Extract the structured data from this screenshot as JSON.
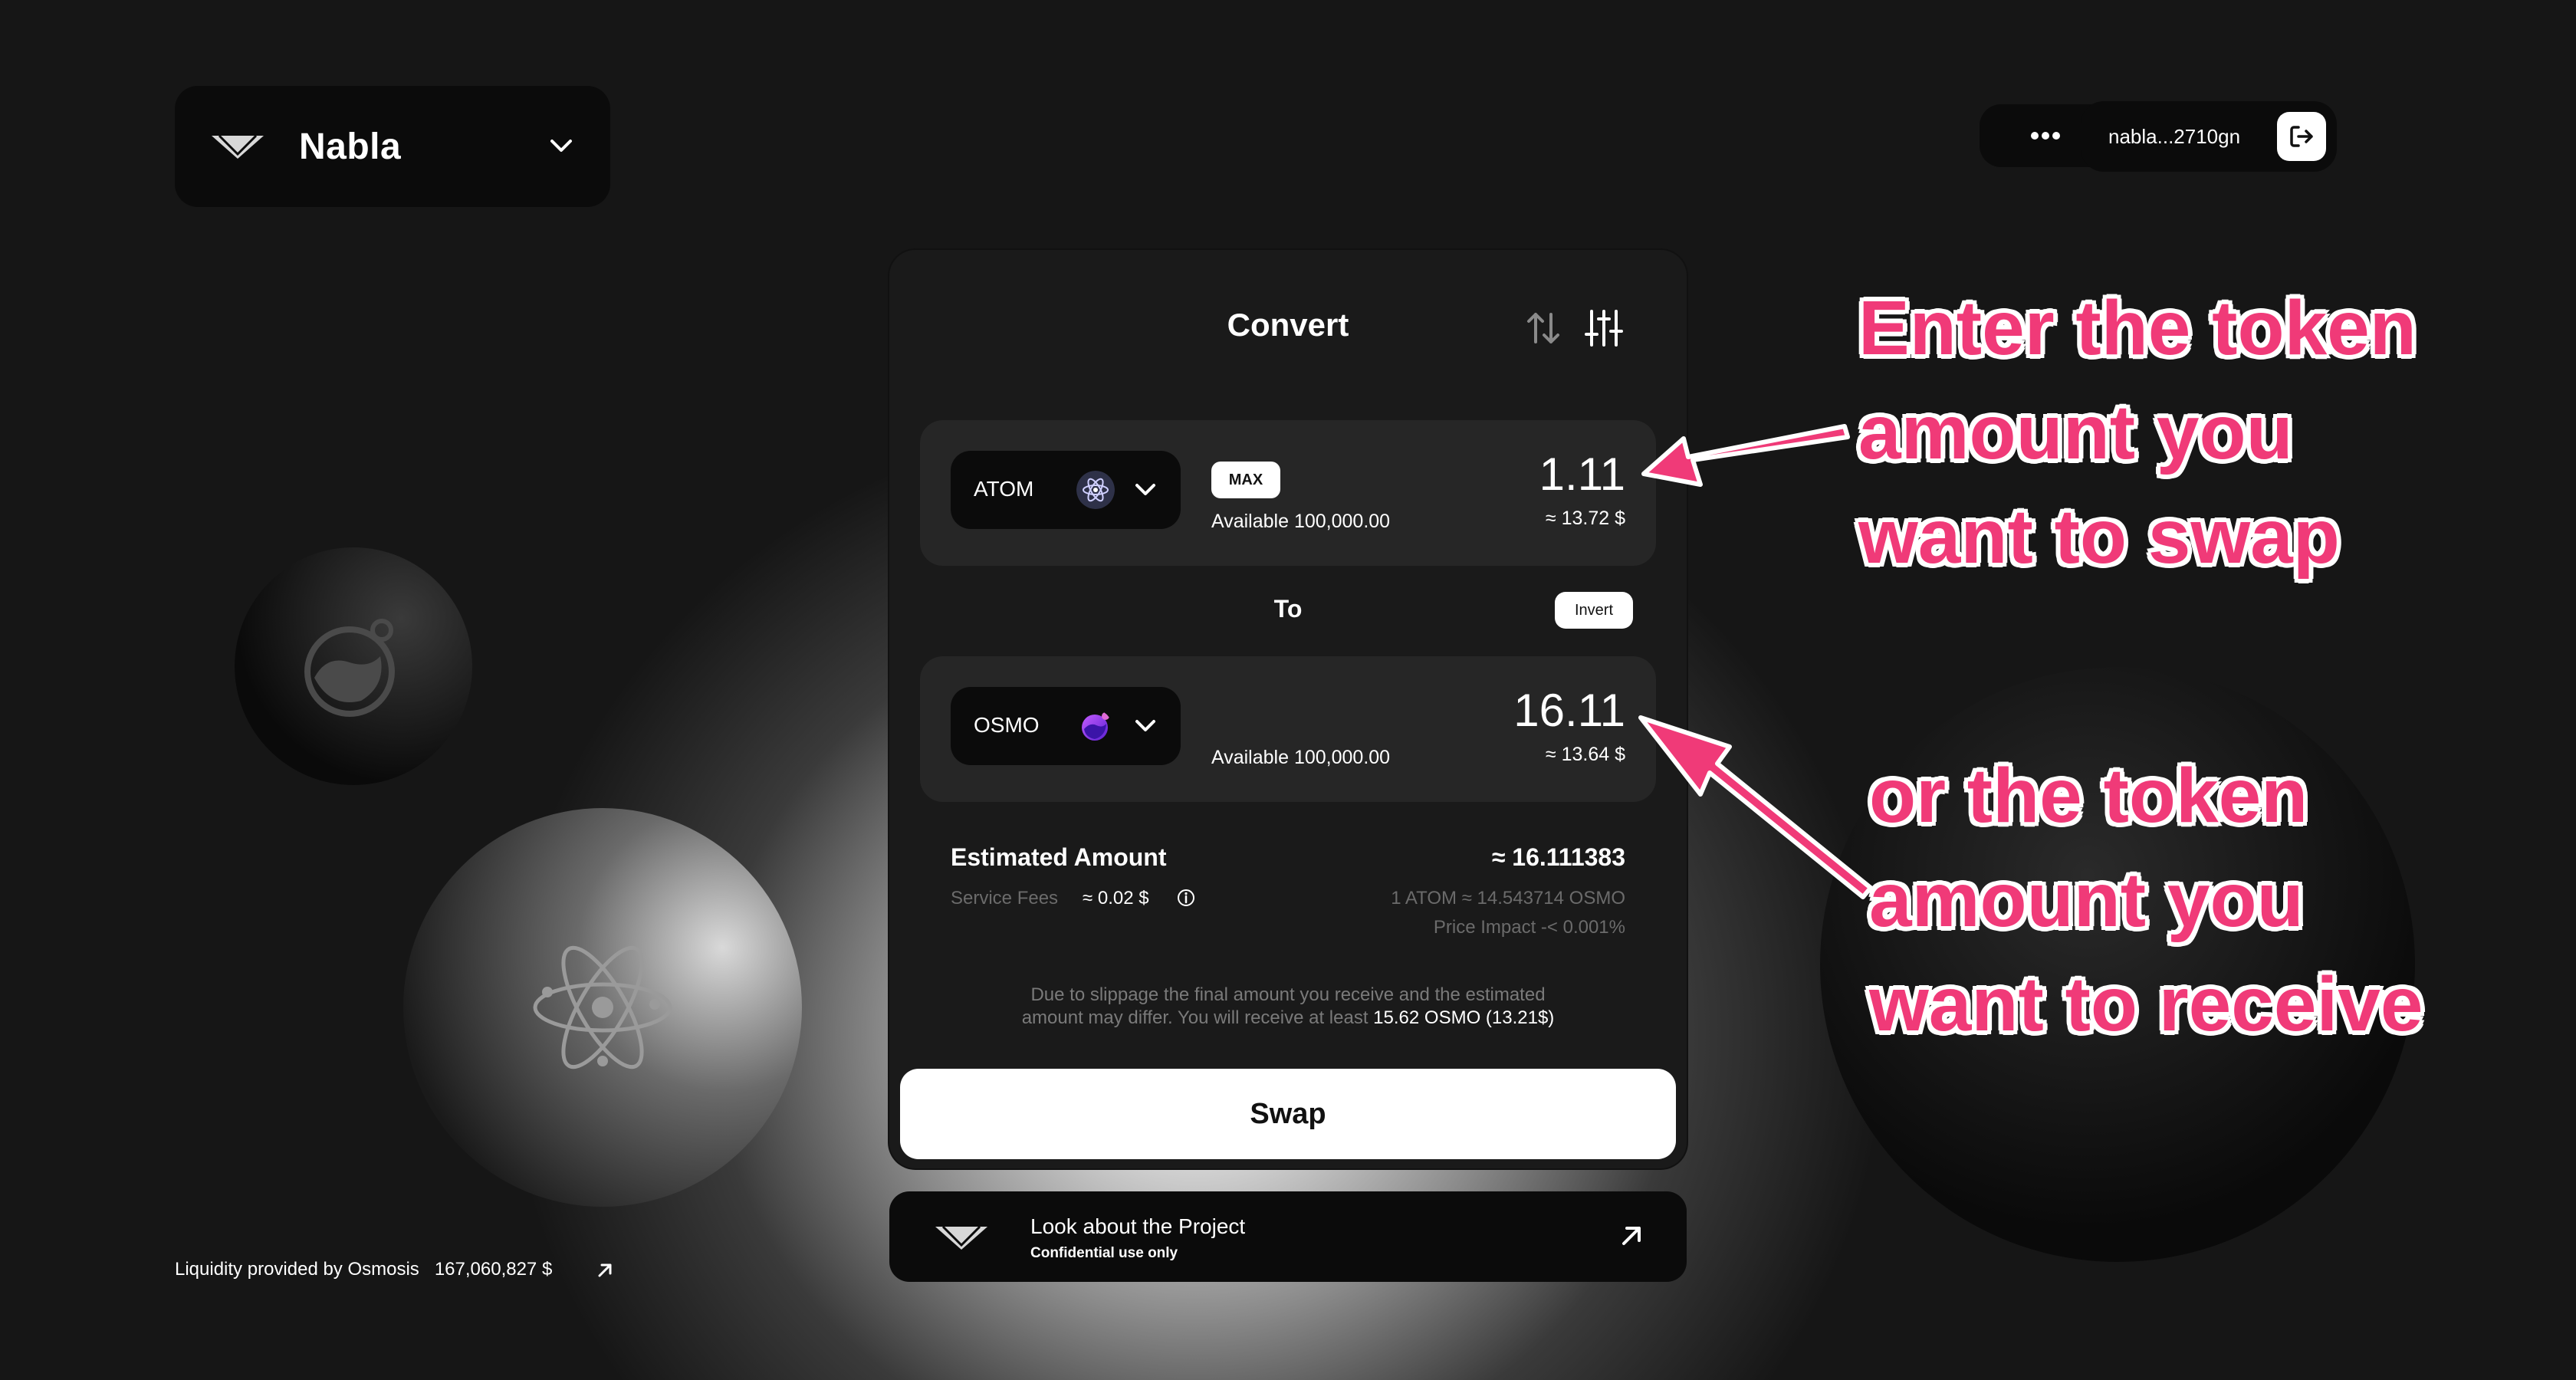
{
  "header": {
    "brand_name": "Nabla",
    "wallet_address": "nabla...2710gn"
  },
  "convert": {
    "title": "Convert",
    "from": {
      "token": "ATOM",
      "max_label": "MAX",
      "available": "Available 100,000.00",
      "amount": "1.11",
      "usd": "≈ 13.72 $"
    },
    "to_label": "To",
    "invert_label": "Invert",
    "to": {
      "token": "OSMO",
      "available": "Available 100,000.00",
      "amount": "16.11",
      "usd": "≈ 13.64 $"
    },
    "estimated_label": "Estimated Amount",
    "estimated_value": "≈ 16.111383",
    "fees_label": "Service Fees",
    "fees_value": "≈ 0.02 $",
    "rate": "1 ATOM ≈ 14.543714 OSMO",
    "price_impact": "Price Impact -< 0.001%",
    "slippage_line1": "Due to slippage the final amount you receive and the estimated",
    "slippage_line2": "amount may differ. You will receive at least",
    "slippage_min": "15.62 OSMO (13.21$)",
    "swap_label": "Swap"
  },
  "project": {
    "title": "Look about the Project",
    "subtitle": "Confidential use only"
  },
  "footer": {
    "liquidity_label": "Liquidity provided by Osmosis",
    "liquidity_value": "167,060,827 $"
  },
  "annotations": {
    "top": [
      "Enter the token",
      "amount you",
      "want to swap"
    ],
    "bottom": [
      "or the token",
      "amount you",
      "want to receive"
    ]
  },
  "colors": {
    "annotation": "#f03a78",
    "osmo_icon": "#7b2cf0"
  }
}
